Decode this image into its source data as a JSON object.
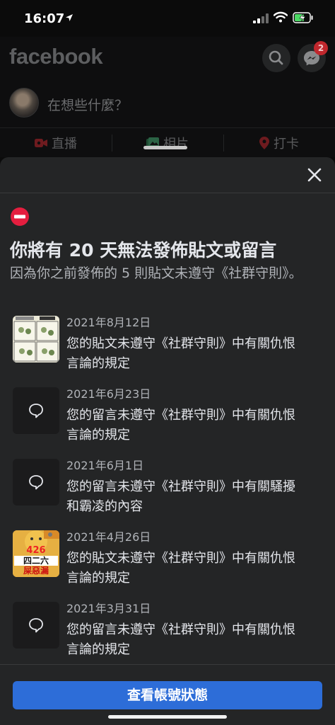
{
  "status_bar": {
    "time": "16:07"
  },
  "header": {
    "logo": "facebook",
    "notification_count": "2",
    "composer_placeholder": "在想些什麼？",
    "actions": [
      {
        "label": "直播",
        "icon": "video-icon",
        "color": "#c0272d"
      },
      {
        "label": "相片",
        "icon": "photo-icon",
        "color": "#2e7d4f"
      },
      {
        "label": "打卡",
        "icon": "location-pin-icon",
        "color": "#c0272d"
      }
    ]
  },
  "sheet": {
    "headline": "你將有 20 天無法發佈貼文或留言",
    "subline": "因為你之前發佈的 5 則貼文未遵守《社群守則》。",
    "items": [
      {
        "date": "2021年8月12日",
        "text": "您的貼文未遵守《社群守則》中有關仇恨言論的規定",
        "thumb": "comic-image"
      },
      {
        "date": "2021年6月23日",
        "text": "您的留言未遵守《社群守則》中有關仇恨言論的規定",
        "thumb": "comment-icon"
      },
      {
        "date": "2021年6月1日",
        "text": "您的留言未遵守《社群守則》中有關騷擾和霸凌的內容",
        "thumb": "comment-icon"
      },
      {
        "date": "2021年4月26日",
        "text": "您的貼文未遵守《社群守則》中有關仇恨言論的規定",
        "thumb": "meme-image",
        "thumb_text_1": "426",
        "thumb_text_2": "四二六",
        "thumb_text_3": "屎惡漏"
      },
      {
        "date": "2021年3月31日",
        "text": "您的留言未遵守《社群守則》中有關仇恨言論的規定",
        "thumb": "comment-icon"
      }
    ],
    "button_label": "查看帳號狀態"
  },
  "colors": {
    "accent": "#2d6dd8",
    "danger": "#e41e3f",
    "sheet_bg": "#242526"
  }
}
